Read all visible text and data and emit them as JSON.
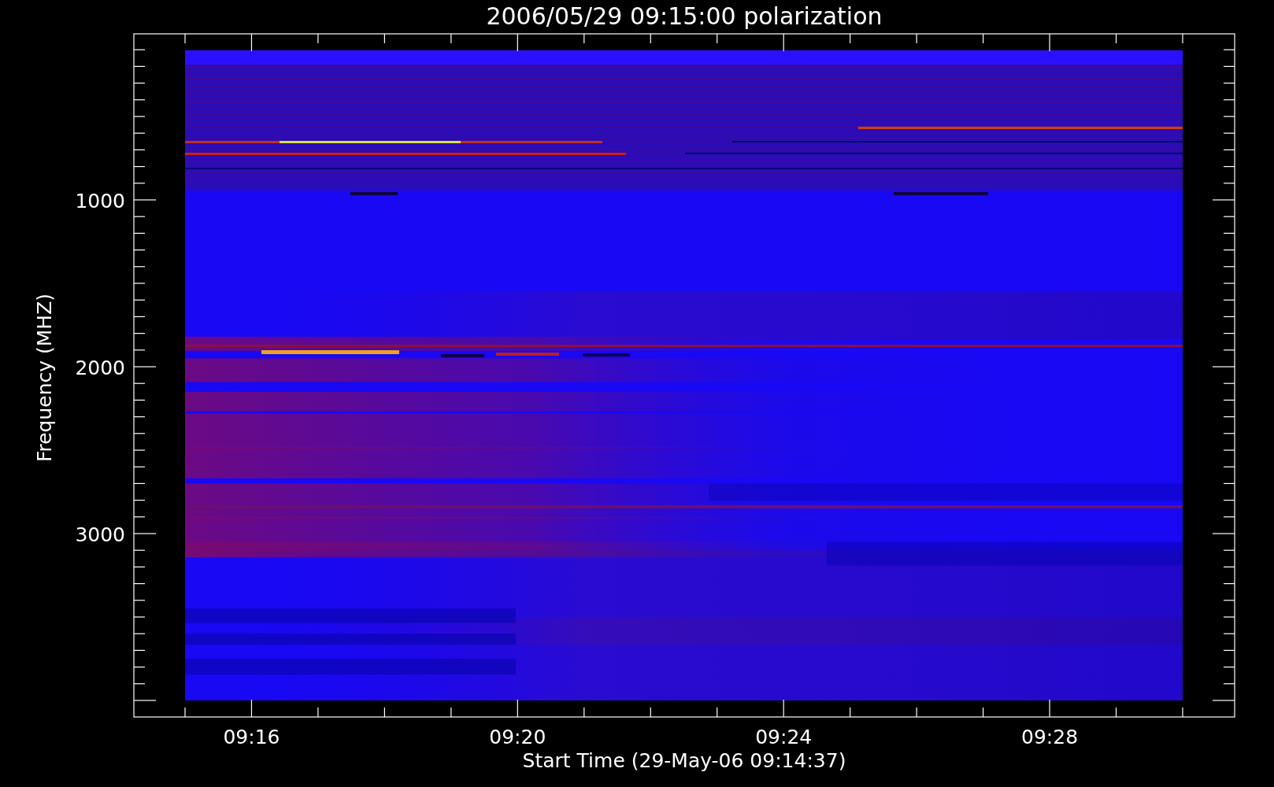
{
  "plot": {
    "title": "2006/05/29 09:15:00 polarization",
    "xlabel": "Start Time (29-May-06 09:14:37)",
    "ylabel": "Frequency (MHZ)",
    "xtick_labels": [
      "09:16",
      "09:20",
      "09:24",
      "09:28"
    ],
    "ytick_labels": [
      "1000",
      "2000",
      "3000"
    ]
  }
}
